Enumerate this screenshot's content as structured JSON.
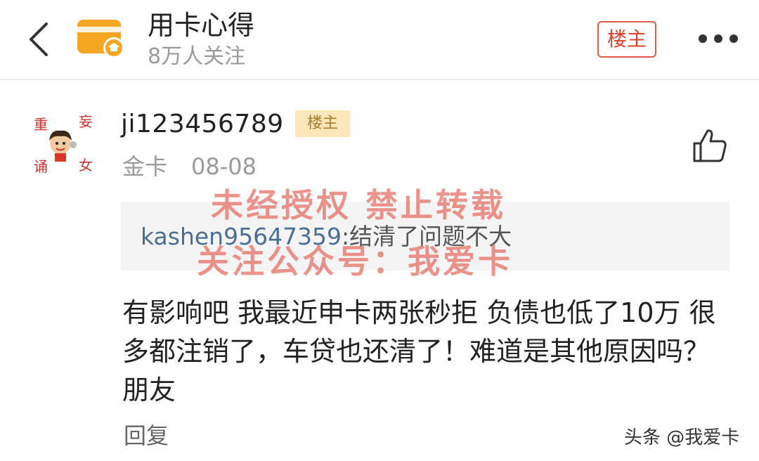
{
  "header": {
    "forum_title": "用卡心得",
    "followers": "8万人关注",
    "owner_only_button": "楼主",
    "icons": [
      "chevron-left-icon",
      "forum-card-icon",
      "more-icon"
    ]
  },
  "post": {
    "avatar_text": [
      "重",
      "妄",
      "诵",
      "女"
    ],
    "username": "ji123456789",
    "owner_badge": "楼主",
    "level": "金卡",
    "date": "08-08",
    "quote": {
      "user": "kashen95647359",
      "text": ":结清了问题不大"
    },
    "content": "有影响吧 我最近申卡两张秒拒 负债也低了10万 很多都注销了，车贷也还清了！难道是其他原因吗？朋友",
    "reply_label": "回复",
    "like_icon": "thumbs-up-icon"
  },
  "watermark": {
    "line1": "未经授权 禁止转载",
    "line2": "关注公众号：我爱卡"
  },
  "attribution": "头条 @我爱卡",
  "colors": {
    "accent_red": "#e0402c",
    "badge_bg": "#fbe7b9",
    "badge_text": "#a87d2a",
    "forum_icon": "#f5a623",
    "link_blue": "#4a6f94"
  }
}
